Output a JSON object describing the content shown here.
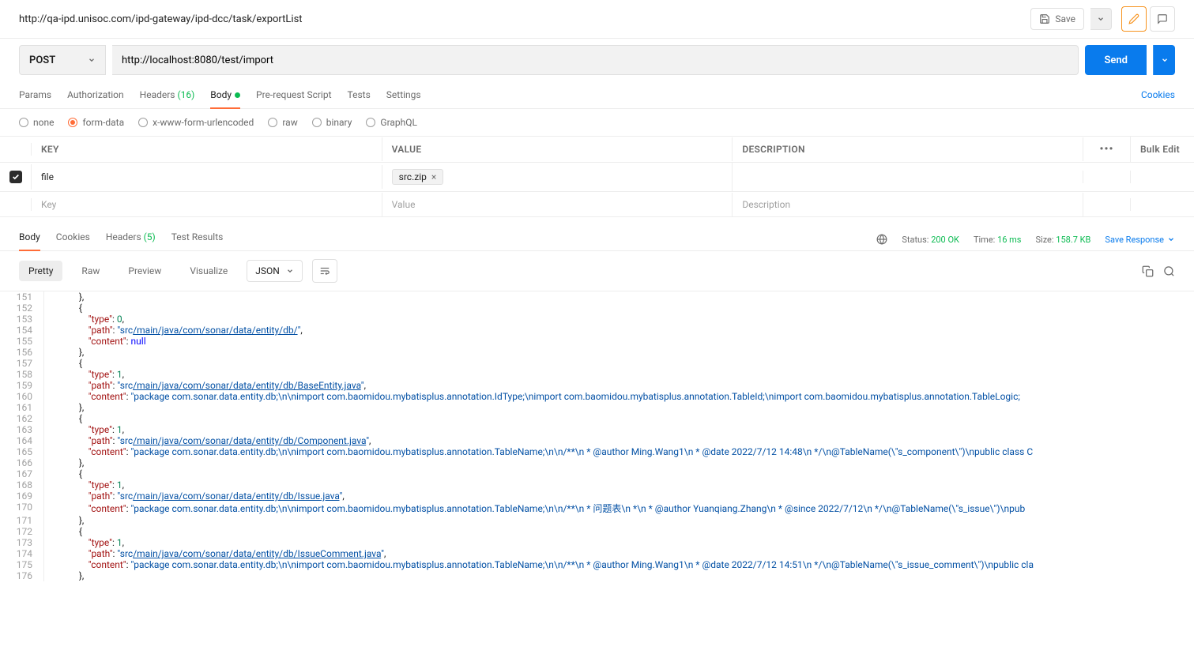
{
  "topbar": {
    "title": "http://qa-ipd.unisoc.com/ipd-gateway/ipd-dcc/task/exportList",
    "save_label": "Save"
  },
  "request": {
    "method": "POST",
    "url": "http://localhost:8080/test/import",
    "send_label": "Send"
  },
  "tabs": {
    "params": "Params",
    "authorization": "Authorization",
    "headers": "Headers",
    "headers_count": "(16)",
    "body": "Body",
    "prerequest": "Pre-request Script",
    "tests": "Tests",
    "settings": "Settings",
    "cookies": "Cookies"
  },
  "body_types": {
    "none": "none",
    "formdata": "form-data",
    "xwww": "x-www-form-urlencoded",
    "raw": "raw",
    "binary": "binary",
    "graphql": "GraphQL"
  },
  "table": {
    "key_header": "KEY",
    "value_header": "VALUE",
    "desc_header": "DESCRIPTION",
    "bulk_edit": "Bulk Edit",
    "row1_key": "file",
    "row1_file": "src.zip",
    "key_placeholder": "Key",
    "value_placeholder": "Value",
    "desc_placeholder": "Description"
  },
  "response_tabs": {
    "body": "Body",
    "cookies": "Cookies",
    "headers": "Headers",
    "headers_count": "(5)",
    "test_results": "Test Results"
  },
  "response_meta": {
    "status_label": "Status:",
    "status_value": "200 OK",
    "time_label": "Time:",
    "time_value": "16 ms",
    "size_label": "Size:",
    "size_value": "158.7 KB",
    "save_response": "Save Response"
  },
  "view": {
    "pretty": "Pretty",
    "raw": "Raw",
    "preview": "Preview",
    "visualize": "Visualize",
    "format": "JSON"
  },
  "code": {
    "lines": [
      {
        "n": 151,
        "indent": 2,
        "t": "brace",
        "v": "},"
      },
      {
        "n": 152,
        "indent": 2,
        "t": "brace",
        "v": "{"
      },
      {
        "n": 153,
        "indent": 3,
        "t": "kv",
        "k": "\"type\"",
        "v": "0",
        "vt": "num",
        "c": ","
      },
      {
        "n": 154,
        "indent": 3,
        "t": "kv",
        "k": "\"path\"",
        "v": "\"src/main/java/com/sonar/data/entity/db/\"",
        "vt": "str-link",
        "c": ","
      },
      {
        "n": 155,
        "indent": 3,
        "t": "kv",
        "k": "\"content\"",
        "v": "null",
        "vt": "null",
        "c": ""
      },
      {
        "n": 156,
        "indent": 2,
        "t": "brace",
        "v": "},"
      },
      {
        "n": 157,
        "indent": 2,
        "t": "brace",
        "v": "{"
      },
      {
        "n": 158,
        "indent": 3,
        "t": "kv",
        "k": "\"type\"",
        "v": "1",
        "vt": "num",
        "c": ","
      },
      {
        "n": 159,
        "indent": 3,
        "t": "kv",
        "k": "\"path\"",
        "v": "\"src/main/java/com/sonar/data/entity/db/BaseEntity.java\"",
        "vt": "str-link",
        "c": ","
      },
      {
        "n": 160,
        "indent": 3,
        "t": "kv",
        "k": "\"content\"",
        "v": "\"package com.sonar.data.entity.db;\\n\\nimport com.baomidou.mybatisplus.annotation.IdType;\\nimport com.baomidou.mybatisplus.annotation.TableId;\\nimport com.baomidou.mybatisplus.annotation.TableLogic;",
        "vt": "str",
        "c": ""
      },
      {
        "n": 161,
        "indent": 2,
        "t": "brace",
        "v": "},"
      },
      {
        "n": 162,
        "indent": 2,
        "t": "brace",
        "v": "{"
      },
      {
        "n": 163,
        "indent": 3,
        "t": "kv",
        "k": "\"type\"",
        "v": "1",
        "vt": "num",
        "c": ","
      },
      {
        "n": 164,
        "indent": 3,
        "t": "kv",
        "k": "\"path\"",
        "v": "\"src/main/java/com/sonar/data/entity/db/Component.java\"",
        "vt": "str-link",
        "c": ","
      },
      {
        "n": 165,
        "indent": 3,
        "t": "kv",
        "k": "\"content\"",
        "v": "\"package com.sonar.data.entity.db;\\n\\nimport com.baomidou.mybatisplus.annotation.TableName;\\n\\n/**\\n * @author Ming.Wang1\\n * @date 2022/7/12 14:48\\n */\\n@TableName(\\\"s_component\\\")\\npublic class C",
        "vt": "str",
        "c": ""
      },
      {
        "n": 166,
        "indent": 2,
        "t": "brace",
        "v": "},"
      },
      {
        "n": 167,
        "indent": 2,
        "t": "brace",
        "v": "{"
      },
      {
        "n": 168,
        "indent": 3,
        "t": "kv",
        "k": "\"type\"",
        "v": "1",
        "vt": "num",
        "c": ","
      },
      {
        "n": 169,
        "indent": 3,
        "t": "kv",
        "k": "\"path\"",
        "v": "\"src/main/java/com/sonar/data/entity/db/Issue.java\"",
        "vt": "str-link",
        "c": ","
      },
      {
        "n": 170,
        "indent": 3,
        "t": "kv",
        "k": "\"content\"",
        "v": "\"package com.sonar.data.entity.db;\\n\\nimport com.baomidou.mybatisplus.annotation.TableName;\\n\\n/**\\n * 问题表\\n *\\n * @author Yuanqiang.Zhang\\n * @since 2022/7/12\\n */\\n@TableName(\\\"s_issue\\\")\\npub",
        "vt": "str",
        "c": ""
      },
      {
        "n": 171,
        "indent": 2,
        "t": "brace",
        "v": "},"
      },
      {
        "n": 172,
        "indent": 2,
        "t": "brace",
        "v": "{"
      },
      {
        "n": 173,
        "indent": 3,
        "t": "kv",
        "k": "\"type\"",
        "v": "1",
        "vt": "num",
        "c": ","
      },
      {
        "n": 174,
        "indent": 3,
        "t": "kv",
        "k": "\"path\"",
        "v": "\"src/main/java/com/sonar/data/entity/db/IssueComment.java\"",
        "vt": "str-link",
        "c": ","
      },
      {
        "n": 175,
        "indent": 3,
        "t": "kv",
        "k": "\"content\"",
        "v": "\"package com.sonar.data.entity.db;\\n\\nimport com.baomidou.mybatisplus.annotation.TableName;\\n\\n/**\\n * @author Ming.Wang1\\n * @date 2022/7/12 14:51\\n */\\n@TableName(\\\"s_issue_comment\\\")\\npublic cla",
        "vt": "str",
        "c": ""
      },
      {
        "n": 176,
        "indent": 2,
        "t": "brace",
        "v": "},"
      }
    ]
  }
}
